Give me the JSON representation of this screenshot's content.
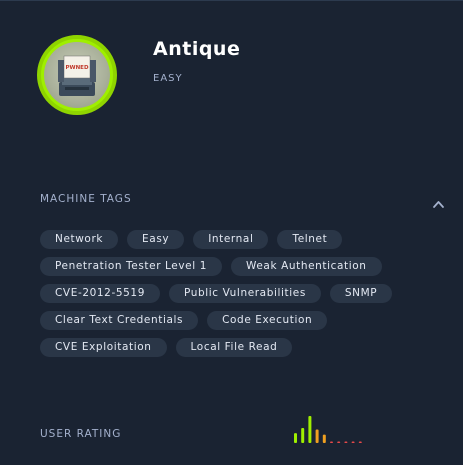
{
  "machine": {
    "name": "Antique",
    "difficulty": "EASY",
    "avatar_label": "PWNED"
  },
  "sections": {
    "tags_label": "MACHINE TAGS",
    "rating_label": "USER RATING"
  },
  "tags": [
    [
      "Network",
      "Easy",
      "Internal",
      "Telnet"
    ],
    [
      "Penetration Tester Level 1",
      "Weak Authentication"
    ],
    [
      "CVE-2012-5519",
      "Public Vulnerabilities",
      "SNMP"
    ],
    [
      "Clear Text Credentials",
      "Code Execution"
    ],
    [
      "CVE Exploitation",
      "Local File Read"
    ]
  ],
  "icons": {
    "collapse": "chevron-up-icon"
  },
  "colors": {
    "background": "#1a2332",
    "tag_background": "#2a3647",
    "accent_green": "#9fef00"
  },
  "rating_bars": [
    {
      "value": 0.33,
      "color": "#9fef00"
    },
    {
      "value": 0.5,
      "color": "#9fef00"
    },
    {
      "value": 0.9,
      "color": "#9fef00"
    },
    {
      "value": 0.45,
      "color": "#f0a020"
    },
    {
      "value": 0.28,
      "color": "#f0a020"
    },
    {
      "value": 0.05,
      "color": "#e84a4a"
    },
    {
      "value": 0.05,
      "color": "#e84a4a"
    },
    {
      "value": 0.05,
      "color": "#e84a4a"
    },
    {
      "value": 0.05,
      "color": "#e84a4a"
    },
    {
      "value": 0.05,
      "color": "#e84a4a"
    }
  ]
}
